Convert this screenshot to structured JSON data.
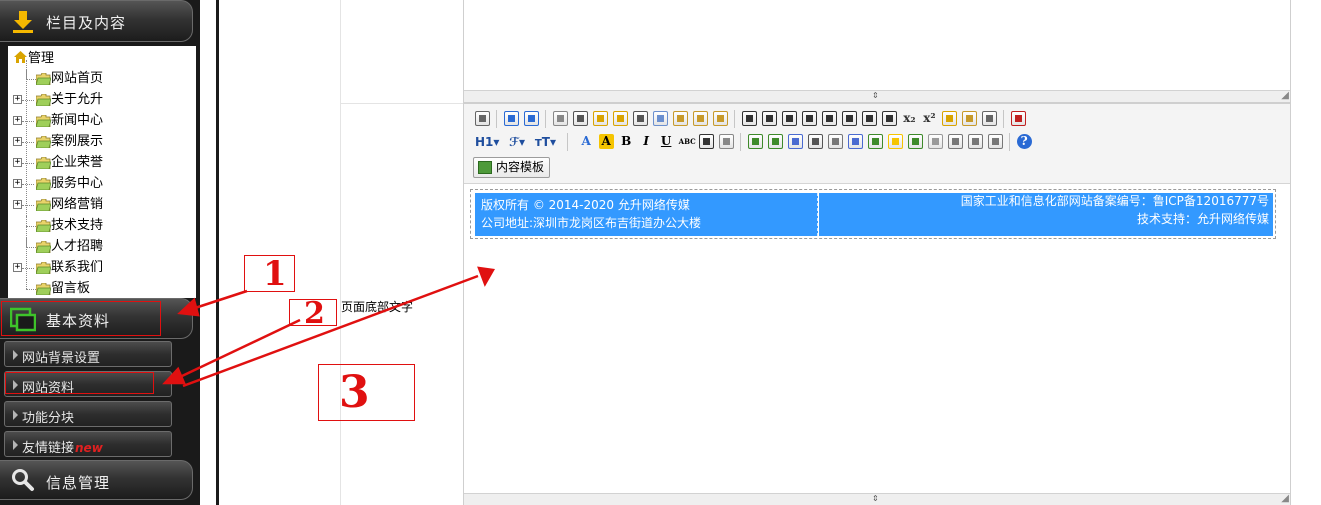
{
  "sidebar": {
    "section_content": {
      "label": "栏目及内容",
      "icon": "download-arrow-icon"
    },
    "tree": {
      "root_label": "管理",
      "items": [
        {
          "label": "网站首页",
          "expandable": false
        },
        {
          "label": "关于允升",
          "expandable": true
        },
        {
          "label": "新闻中心",
          "expandable": true
        },
        {
          "label": "案例展示",
          "expandable": true
        },
        {
          "label": "企业荣誉",
          "expandable": true
        },
        {
          "label": "服务中心",
          "expandable": true
        },
        {
          "label": "网络营销",
          "expandable": true
        },
        {
          "label": "技术支持",
          "expandable": false
        },
        {
          "label": "人才招聘",
          "expandable": false
        },
        {
          "label": "联系我们",
          "expandable": true
        },
        {
          "label": "留言板",
          "expandable": false
        }
      ]
    },
    "section_basic": {
      "label": "基本资料",
      "icon": "windows-icon"
    },
    "basic_items": [
      {
        "label": "网站背景设置"
      },
      {
        "label": "网站资料"
      },
      {
        "label": "功能分块"
      },
      {
        "label": "友情链接",
        "badge": "new"
      }
    ],
    "section_info": {
      "label": "信息管理",
      "icon": "search-icon"
    }
  },
  "main": {
    "row_label": "页面底部文字",
    "editor": {
      "toolbar_row2_text": {
        "heading": "H1",
        "font": "ℱ",
        "size": "тT"
      },
      "template_button": "内容模板",
      "footer": {
        "left_line1": "版权所有 © 2014-2020 允升网络传媒",
        "left_line2": "公司地址:深圳市龙岗区布吉街道办公大楼",
        "right_line1": "国家工业和信息化部网站备案编号：鲁ICP备12016777号",
        "right_line2": "技术支持：允升网络传媒"
      }
    }
  },
  "annotations": {
    "one": "1",
    "two": "2",
    "three": "3",
    "color": "#e01010"
  }
}
